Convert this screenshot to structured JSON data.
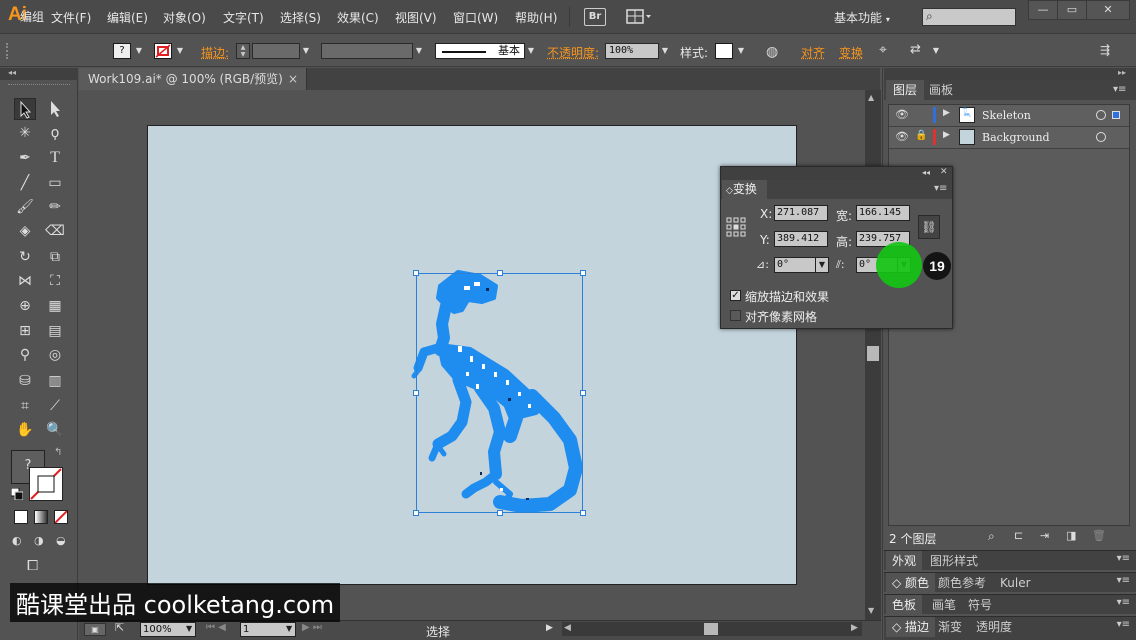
{
  "app": {
    "logo": "Ai",
    "workspace": "基本功能",
    "br_label": "Br"
  },
  "menu": [
    "文件(F)",
    "编辑(E)",
    "对象(O)",
    "文字(T)",
    "选择(S)",
    "效果(C)",
    "视图(V)",
    "窗口(W)",
    "帮助(H)"
  ],
  "control_bar": {
    "selection_label": "编组",
    "stroke_label": "描边:",
    "brush_label": "基本",
    "opacity_label": "不透明度:",
    "opacity_value": "100%",
    "style_label": "样式:",
    "align_label": "对齐",
    "transform_label": "变换"
  },
  "document": {
    "tab_title": "Work109.ai* @ 100% (RGB/预览)",
    "close": "×"
  },
  "status_bar": {
    "zoom": "100%",
    "page": "1",
    "tool": "选择"
  },
  "layers_panel": {
    "tabs": [
      "图层",
      "画板"
    ],
    "layers": [
      {
        "name": "Skeleton",
        "color": "#2f6fe0",
        "locked": false
      },
      {
        "name": "Background",
        "color": "#e03030",
        "locked": true
      }
    ],
    "count": "2 个图层"
  },
  "mini_panels": [
    {
      "tabs": [
        "外观",
        "图形样式"
      ]
    },
    {
      "tabs": [
        "颜色",
        "颜色参考",
        "Kuler"
      ]
    },
    {
      "tabs": [
        "色板",
        "画笔",
        "符号"
      ]
    },
    {
      "tabs": [
        "描边",
        "渐变",
        "透明度"
      ]
    }
  ],
  "transform_panel": {
    "title": "变换",
    "x_label": "X:",
    "x_value": "271.087",
    "y_label": "Y:",
    "y_value": "389.412",
    "w_label": "宽:",
    "w_value": "166.145",
    "h_label": "高:",
    "h_value": "239.757",
    "rotate_value": "0°",
    "shear_value": "0°",
    "scale_strokes_label": "缩放描边和效果",
    "scale_strokes_checked": "✓",
    "align_pixel_label": "对齐像素网格"
  },
  "step_badge": "19",
  "watermark": "酷课堂出品 coolketang.com",
  "colors": {
    "accent": "#f7941d",
    "selection": "#2d7fd8",
    "artwork": "#1f8cf0",
    "artboard": "#c3d4dd",
    "highlight": "#14c414"
  }
}
